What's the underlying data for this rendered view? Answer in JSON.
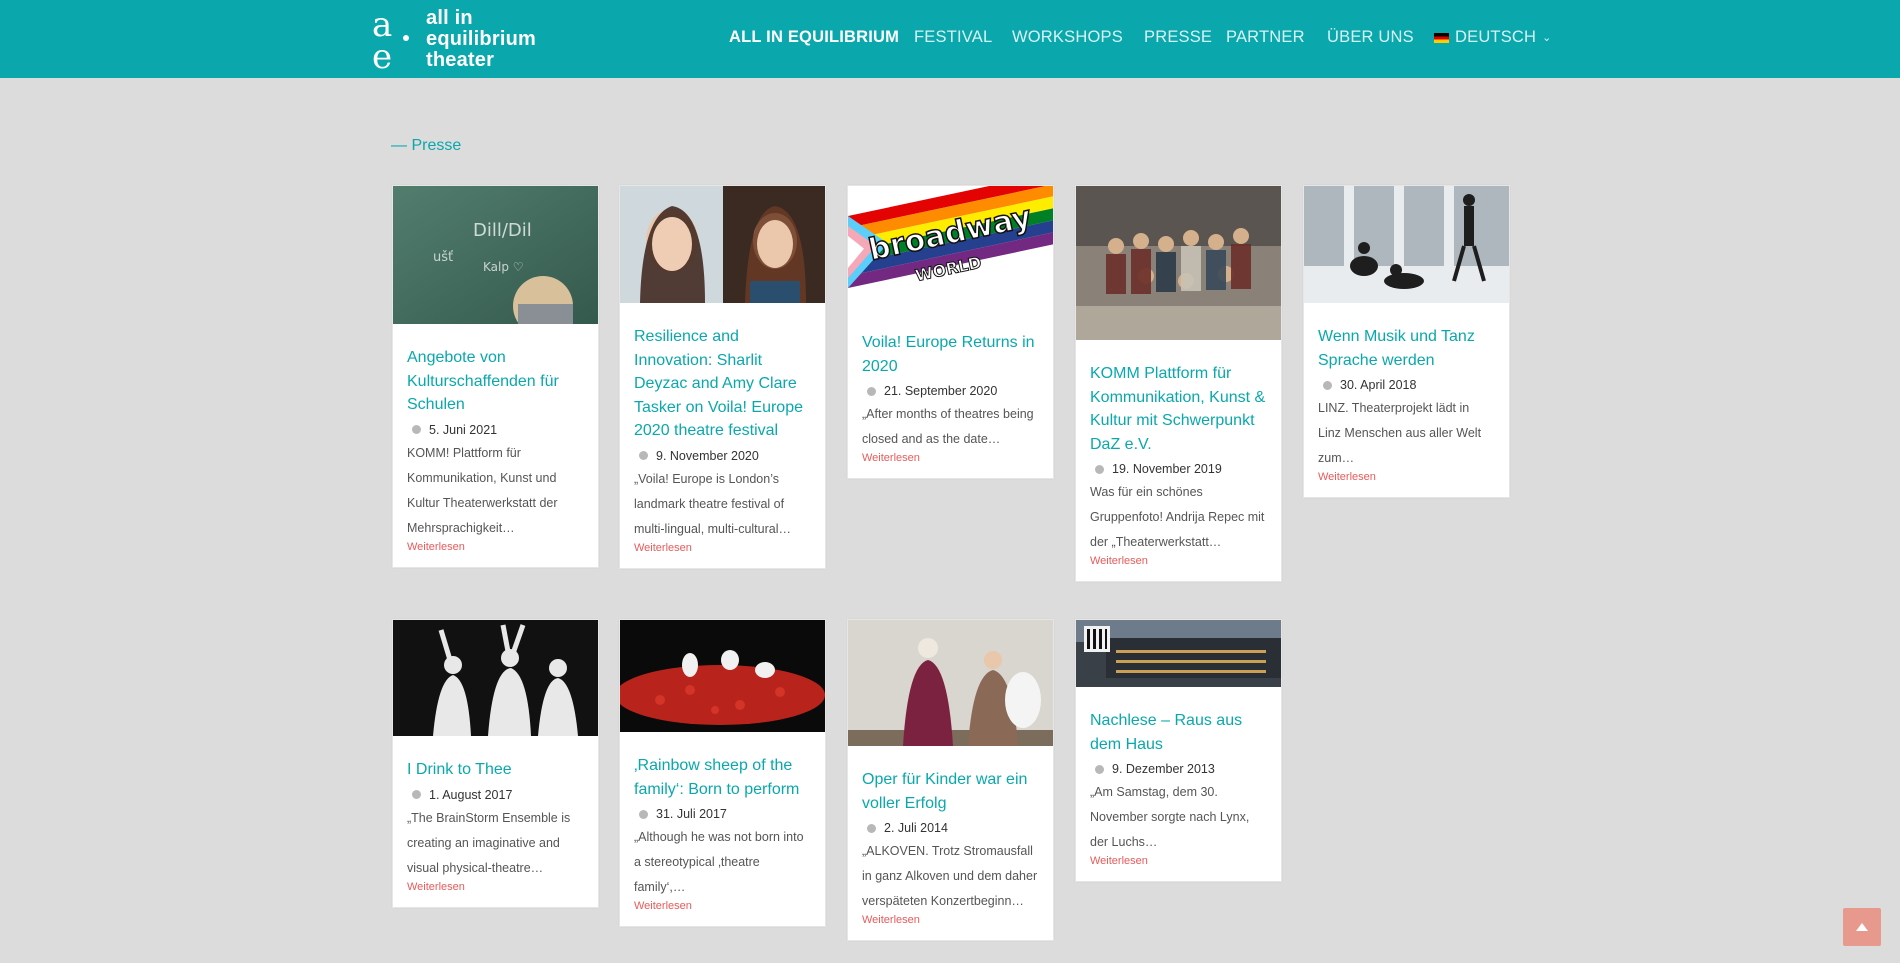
{
  "header": {
    "logo_lines": [
      "all in",
      "equilibrium",
      "theater"
    ],
    "nav": [
      {
        "label": "ALL IN EQUILIBRIUM",
        "active": true
      },
      {
        "label": "FESTIVAL"
      },
      {
        "label": "WORKSHOPS"
      },
      {
        "label": "PRESSE"
      },
      {
        "label": "PARTNER"
      },
      {
        "label": "ÜBER UNS"
      }
    ],
    "language": "DEUTSCH"
  },
  "section": {
    "label": "— Presse"
  },
  "read_more": "Weiterlesen",
  "cards": [
    {
      "title": "Angebote von Kulturschaffenden für Schulen",
      "date": "5. Juni 2021",
      "excerpt": "KOMM! Plattform für Kommunikation, Kunst und Kultur Theaterwerkstatt der Mehrsprachigkeit…",
      "image": "teacher-at-chalkboard"
    },
    {
      "title": "Resilience and Innovation: Sharlit Deyzac and Amy Clare Tasker on Voila! Europe 2020 theatre festival",
      "date": "9. November 2020",
      "excerpt": "„Voila! Europe is London’s landmark theatre festival of multi-lingual, multi-cultural…",
      "image": "two-portraits"
    },
    {
      "title": "Voila! Europe Returns in 2020",
      "date": "21. September 2020",
      "excerpt": "„After months of theatres being closed and as the date…",
      "image": "broadway-world-logo",
      "image_text": [
        "broadway",
        "WORLD"
      ]
    },
    {
      "title": "KOMM Plattform für Kommunikation, Kunst & Kultur mit Schwerpunkt DaZ e.V.",
      "date": "19. November 2019",
      "excerpt": "Was für ein schönes Gruppenfoto! Andrija Repec mit der „Theaterwerkstatt…",
      "image": "group-photo"
    },
    {
      "title": "Wenn Musik und Tanz Sprache werden",
      "date": "30. April 2018",
      "excerpt": "LINZ. Theaterprojekt lädt in Linz Menschen aus aller Welt zum…",
      "image": "dance-rehearsal"
    },
    {
      "title": "I Drink to Thee",
      "date": "1. August 2017",
      "excerpt": "„The BrainStorm Ensemble is creating an imaginative and visual physical-theatre…",
      "image": "performers-in-white"
    },
    {
      "title": "‚Rainbow sheep of the family‘: Born to perform",
      "date": "31. Juli 2017",
      "excerpt": "„Although he was not born into a stereotypical ‚theatre family‘,…",
      "image": "stage-with-red-flowers"
    },
    {
      "title": "Oper für Kinder war ein voller Erfolg",
      "date": "2. Juli 2014",
      "excerpt": "„ALKOVEN. Trotz Stromausfall in ganz Alkoven und dem daher verspäteten Konzertbeginn…",
      "image": "baroque-opera-costumes"
    },
    {
      "title": "Nachlese – Raus aus dem Haus",
      "date": "9. Dezember 2013",
      "excerpt": "„Am Samstag, dem 30. November sorgte nach Lynx, der Luchs…",
      "image": "building-at-dusk"
    }
  ],
  "colors": {
    "brand": "#0aa8ad",
    "link_red": "#e85b5b",
    "background": "#dcdcdc"
  }
}
